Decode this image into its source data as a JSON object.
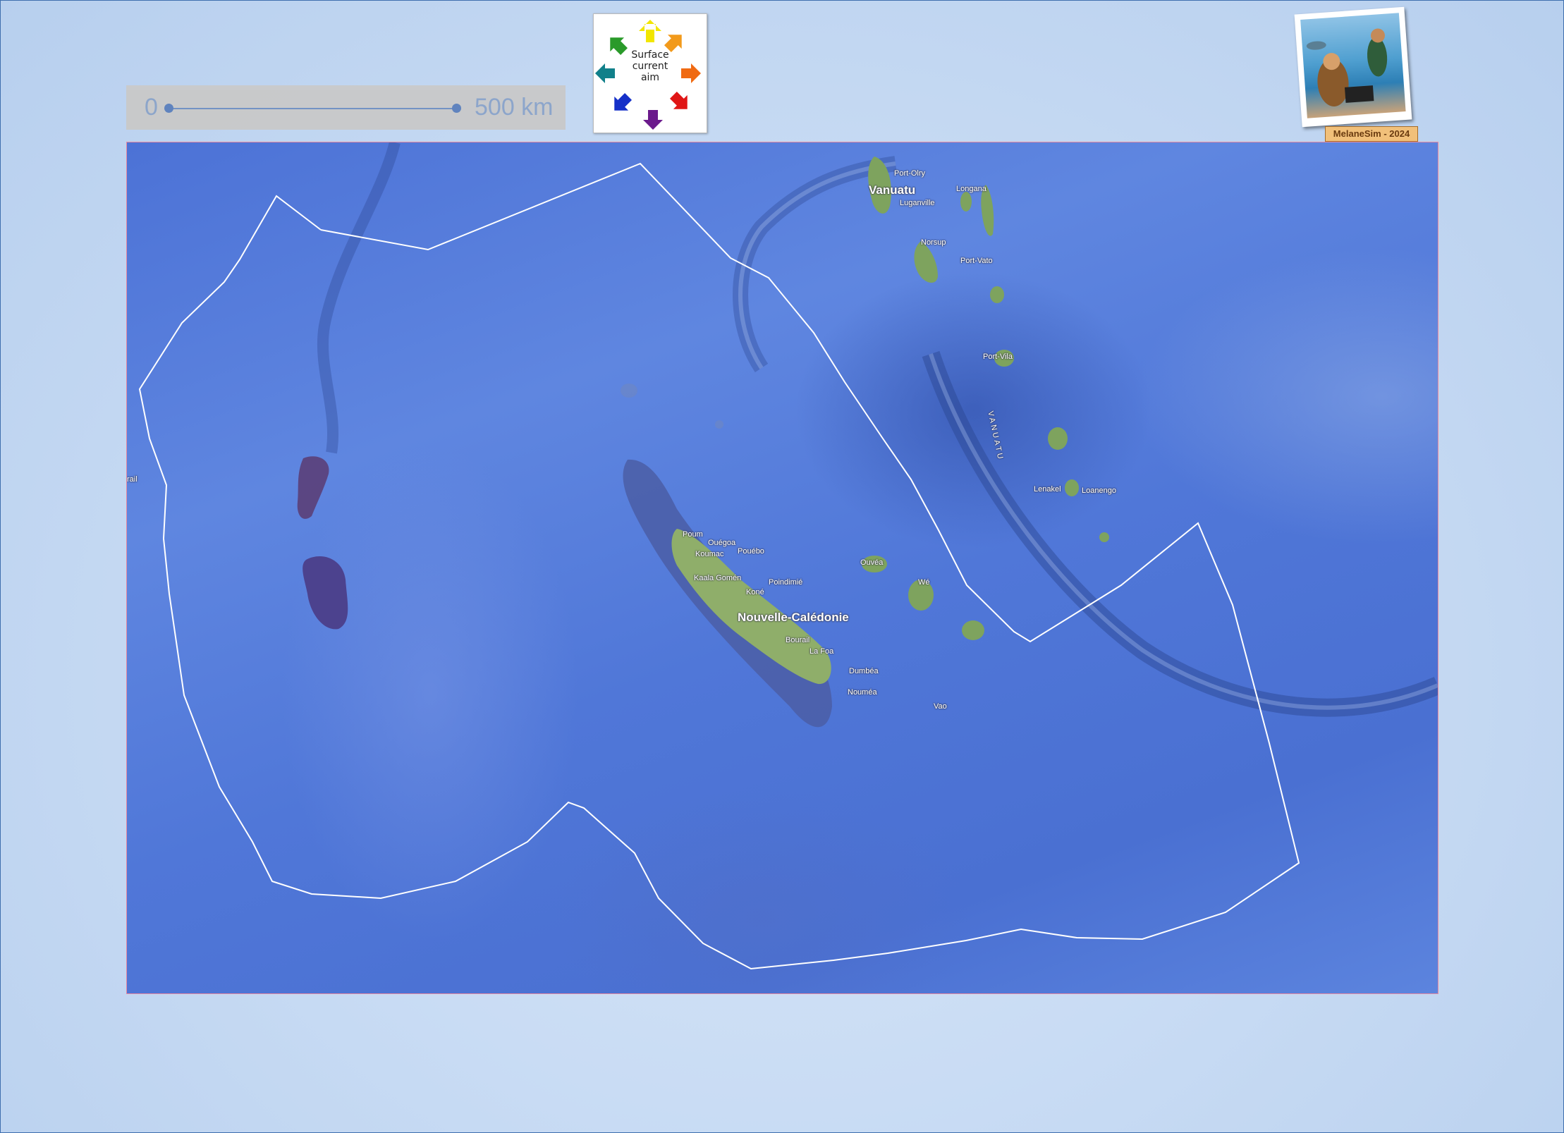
{
  "scale_bar": {
    "zero_label": "0",
    "max_label": "500 km"
  },
  "legend": {
    "text": "Surface\ncurrent\naim",
    "icon": "compass-arrows-icon"
  },
  "logo": {
    "caption": "MelaneSim - 2024"
  },
  "map": {
    "region": "New Caledonia and Vanuatu",
    "basemap": "satellite-bathymetry",
    "boundary_color": "#ffffff",
    "places": {
      "port_olry": "Port-Olry",
      "vanuatu": "Vanuatu",
      "luganville": "Luganville",
      "longana": "Longana",
      "norsup": "Norsup",
      "port_vato": "Port-Vato",
      "port_vila": "Port-Vila",
      "vanuatu_vertical": "VANUATU",
      "lenakel": "Lenakel",
      "loanengo": "Loanengo",
      "poum": "Poum",
      "ouegoa": "Ouégoa",
      "kouniac": "Koumac",
      "pouebo": "Pouébo",
      "kaala_gomen": "Kaala Gomén",
      "poindimie": "Poindimié",
      "kone": "Koné",
      "nouvelle_caledonie": "Nouvelle-Calédonie",
      "bourail": "Bourail",
      "la_foa": "La Foa",
      "dumbea": "Dumbéa",
      "noumea": "Nouméa",
      "vao": "Vao",
      "ouvea": "Ouvéa",
      "we": "Wé",
      "rail_edge": "rail"
    }
  }
}
